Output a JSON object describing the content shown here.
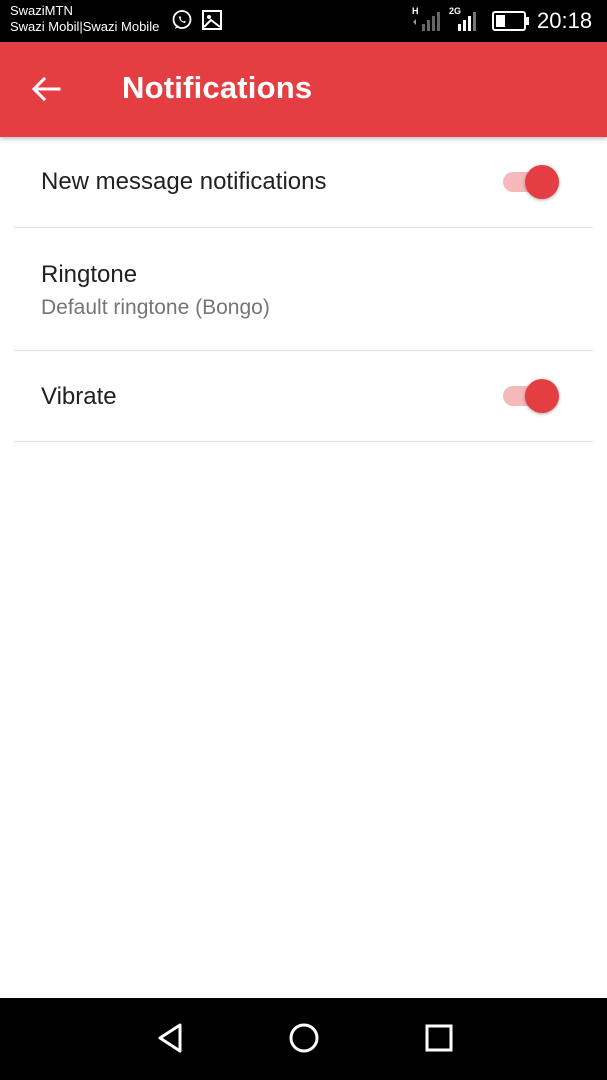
{
  "status_bar": {
    "carrier_line1": "SwaziMTN",
    "carrier_line2": "Swazi Mobil|Swazi Mobile",
    "net1": "H",
    "net2": "2G",
    "time": "20:18",
    "icons": [
      "whatsapp-icon",
      "image-icon",
      "signal-icon",
      "signal-icon",
      "battery-icon"
    ]
  },
  "app_bar": {
    "title": "Notifications",
    "back_icon": "arrow-back-icon",
    "color": "#e53e42"
  },
  "settings": [
    {
      "title": "New message notifications",
      "toggle": true
    },
    {
      "title": "Ringtone",
      "subtitle": "Default ringtone (Bongo)"
    },
    {
      "title": "Vibrate",
      "toggle": true
    }
  ],
  "nav_bar": {
    "icons": [
      "nav-back-icon",
      "nav-home-icon",
      "nav-recent-icon"
    ]
  }
}
